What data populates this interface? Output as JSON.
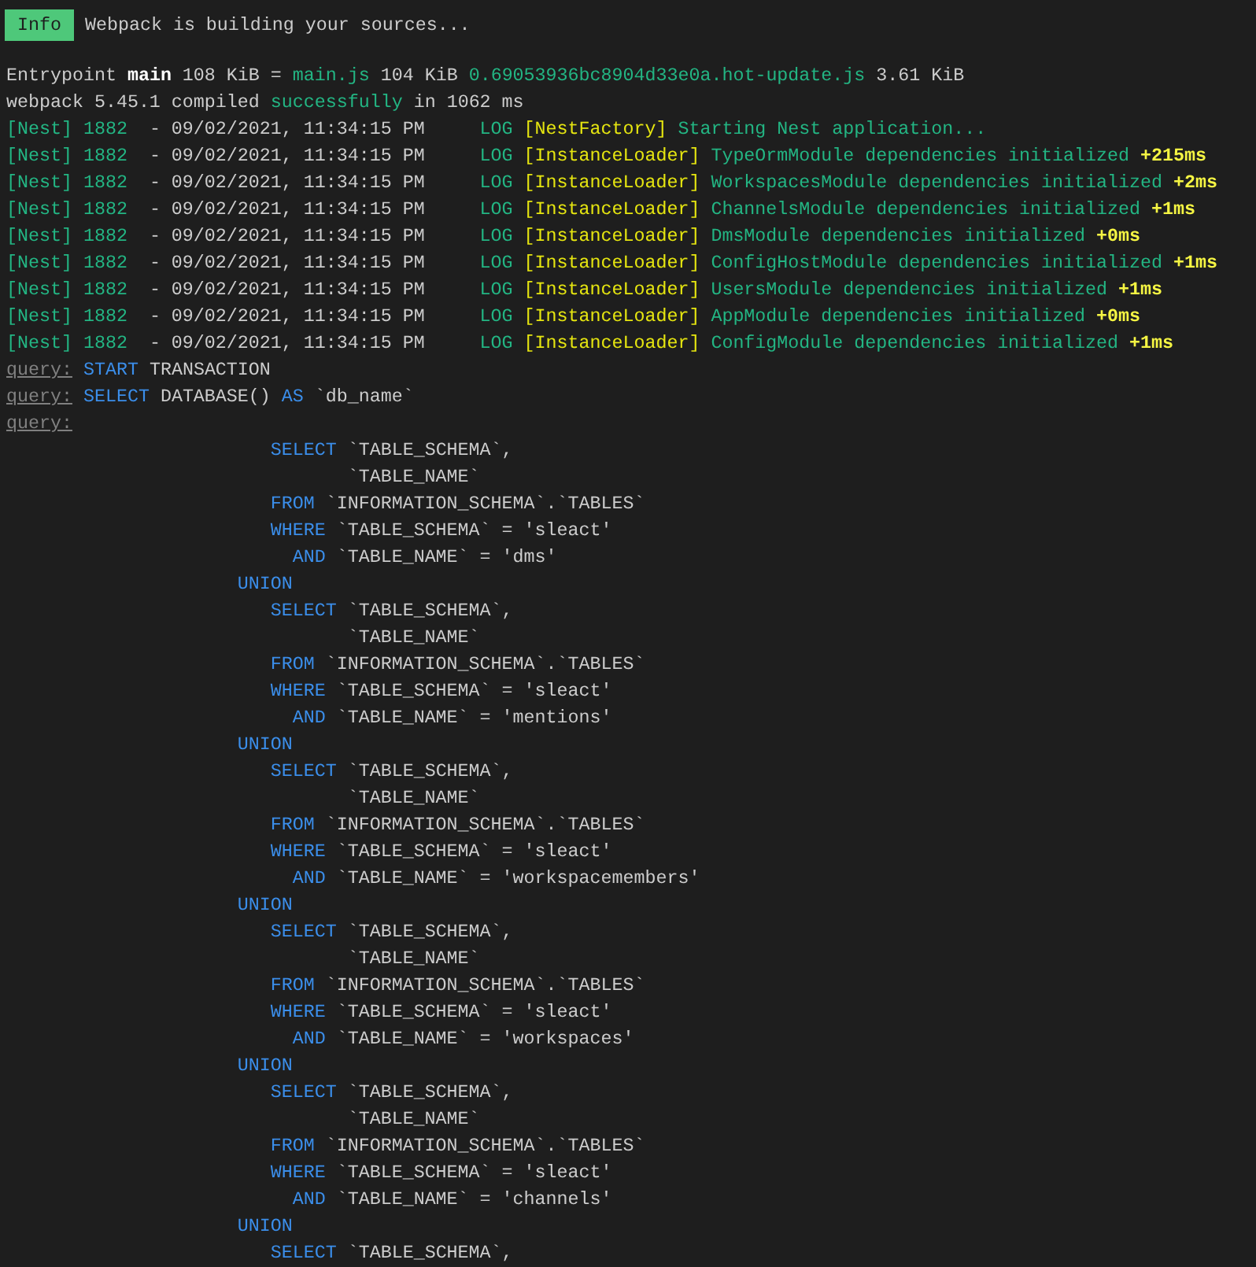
{
  "info": {
    "badge": "Info",
    "message": "Webpack is building your sources..."
  },
  "lines": [
    [
      {
        "kind": "plain",
        "text": "Entrypoint "
      },
      {
        "kind": "bold",
        "text": "main"
      },
      {
        "kind": "plain",
        "text": " 108 KiB = "
      },
      {
        "kind": "green",
        "text": "main.js"
      },
      {
        "kind": "plain",
        "text": " 104 KiB "
      },
      {
        "kind": "green",
        "text": "0.69053936bc8904d33e0a.hot-update.js"
      },
      {
        "kind": "plain",
        "text": " 3.61 KiB"
      }
    ],
    [
      {
        "kind": "plain",
        "text": "webpack 5.45.1 compiled "
      },
      {
        "kind": "green",
        "text": "successfully"
      },
      {
        "kind": "plain",
        "text": " in 1062 ms"
      }
    ],
    [
      {
        "kind": "green",
        "text": "[Nest] 1882"
      },
      {
        "kind": "plain",
        "text": "  - 09/02/2021, 11:34:15 PM     "
      },
      {
        "kind": "green",
        "text": "LOG "
      },
      {
        "kind": "yellow",
        "text": "[NestFactory]"
      },
      {
        "kind": "green",
        "text": " Starting Nest application..."
      }
    ],
    [
      {
        "kind": "green",
        "text": "[Nest] 1882"
      },
      {
        "kind": "plain",
        "text": "  - 09/02/2021, 11:34:15 PM     "
      },
      {
        "kind": "green",
        "text": "LOG "
      },
      {
        "kind": "yellow",
        "text": "[InstanceLoader]"
      },
      {
        "kind": "green",
        "text": " TypeOrmModule dependencies initialized "
      },
      {
        "kind": "timing",
        "text": "+215ms"
      }
    ],
    [
      {
        "kind": "green",
        "text": "[Nest] 1882"
      },
      {
        "kind": "plain",
        "text": "  - 09/02/2021, 11:34:15 PM     "
      },
      {
        "kind": "green",
        "text": "LOG "
      },
      {
        "kind": "yellow",
        "text": "[InstanceLoader]"
      },
      {
        "kind": "green",
        "text": " WorkspacesModule dependencies initialized "
      },
      {
        "kind": "timing",
        "text": "+2ms"
      }
    ],
    [
      {
        "kind": "green",
        "text": "[Nest] 1882"
      },
      {
        "kind": "plain",
        "text": "  - 09/02/2021, 11:34:15 PM     "
      },
      {
        "kind": "green",
        "text": "LOG "
      },
      {
        "kind": "yellow",
        "text": "[InstanceLoader]"
      },
      {
        "kind": "green",
        "text": " ChannelsModule dependencies initialized "
      },
      {
        "kind": "timing",
        "text": "+1ms"
      }
    ],
    [
      {
        "kind": "green",
        "text": "[Nest] 1882"
      },
      {
        "kind": "plain",
        "text": "  - 09/02/2021, 11:34:15 PM     "
      },
      {
        "kind": "green",
        "text": "LOG "
      },
      {
        "kind": "yellow",
        "text": "[InstanceLoader]"
      },
      {
        "kind": "green",
        "text": " DmsModule dependencies initialized "
      },
      {
        "kind": "timing",
        "text": "+0ms"
      }
    ],
    [
      {
        "kind": "green",
        "text": "[Nest] 1882"
      },
      {
        "kind": "plain",
        "text": "  - 09/02/2021, 11:34:15 PM     "
      },
      {
        "kind": "green",
        "text": "LOG "
      },
      {
        "kind": "yellow",
        "text": "[InstanceLoader]"
      },
      {
        "kind": "green",
        "text": " ConfigHostModule dependencies initialized "
      },
      {
        "kind": "timing",
        "text": "+1ms"
      }
    ],
    [
      {
        "kind": "green",
        "text": "[Nest] 1882"
      },
      {
        "kind": "plain",
        "text": "  - 09/02/2021, 11:34:15 PM     "
      },
      {
        "kind": "green",
        "text": "LOG "
      },
      {
        "kind": "yellow",
        "text": "[InstanceLoader]"
      },
      {
        "kind": "green",
        "text": " UsersModule dependencies initialized "
      },
      {
        "kind": "timing",
        "text": "+1ms"
      }
    ],
    [
      {
        "kind": "green",
        "text": "[Nest] 1882"
      },
      {
        "kind": "plain",
        "text": "  - 09/02/2021, 11:34:15 PM     "
      },
      {
        "kind": "green",
        "text": "LOG "
      },
      {
        "kind": "yellow",
        "text": "[InstanceLoader]"
      },
      {
        "kind": "green",
        "text": " AppModule dependencies initialized "
      },
      {
        "kind": "timing",
        "text": "+0ms"
      }
    ],
    [
      {
        "kind": "green",
        "text": "[Nest] 1882"
      },
      {
        "kind": "plain",
        "text": "  - 09/02/2021, 11:34:15 PM     "
      },
      {
        "kind": "green",
        "text": "LOG "
      },
      {
        "kind": "yellow",
        "text": "[InstanceLoader]"
      },
      {
        "kind": "green",
        "text": " ConfigModule dependencies initialized "
      },
      {
        "kind": "timing",
        "text": "+1ms"
      }
    ],
    [
      {
        "kind": "prefix",
        "text": "query:"
      },
      {
        "kind": "keyword",
        "text": " START"
      },
      {
        "kind": "plain",
        "text": " TRANSACTION"
      }
    ],
    [
      {
        "kind": "prefix",
        "text": "query:"
      },
      {
        "kind": "keyword",
        "text": " SELECT"
      },
      {
        "kind": "plain",
        "text": " DATABASE() "
      },
      {
        "kind": "keyword",
        "text": "AS"
      },
      {
        "kind": "plain",
        "text": " `db_name`"
      }
    ],
    [
      {
        "kind": "prefix",
        "text": "query:"
      }
    ],
    [
      {
        "kind": "keyword",
        "text": "                        SELECT"
      },
      {
        "kind": "plain",
        "text": " `TABLE_SCHEMA`,"
      }
    ],
    [
      {
        "kind": "plain",
        "text": "                               `TABLE_NAME`"
      }
    ],
    [
      {
        "kind": "keyword",
        "text": "                        FROM"
      },
      {
        "kind": "plain",
        "text": " `INFORMATION_SCHEMA`.`TABLES`"
      }
    ],
    [
      {
        "kind": "keyword",
        "text": "                        WHERE"
      },
      {
        "kind": "plain",
        "text": " `TABLE_SCHEMA` = 'sleact'"
      }
    ],
    [
      {
        "kind": "keyword",
        "text": "                          AND"
      },
      {
        "kind": "plain",
        "text": " `TABLE_NAME` = 'dms'"
      }
    ],
    [
      {
        "kind": "keyword",
        "text": "                     UNION"
      }
    ],
    [
      {
        "kind": "keyword",
        "text": "                        SELECT"
      },
      {
        "kind": "plain",
        "text": " `TABLE_SCHEMA`,"
      }
    ],
    [
      {
        "kind": "plain",
        "text": "                               `TABLE_NAME`"
      }
    ],
    [
      {
        "kind": "keyword",
        "text": "                        FROM"
      },
      {
        "kind": "plain",
        "text": " `INFORMATION_SCHEMA`.`TABLES`"
      }
    ],
    [
      {
        "kind": "keyword",
        "text": "                        WHERE"
      },
      {
        "kind": "plain",
        "text": " `TABLE_SCHEMA` = 'sleact'"
      }
    ],
    [
      {
        "kind": "keyword",
        "text": "                          AND"
      },
      {
        "kind": "plain",
        "text": " `TABLE_NAME` = 'mentions'"
      }
    ],
    [
      {
        "kind": "keyword",
        "text": "                     UNION"
      }
    ],
    [
      {
        "kind": "keyword",
        "text": "                        SELECT"
      },
      {
        "kind": "plain",
        "text": " `TABLE_SCHEMA`,"
      }
    ],
    [
      {
        "kind": "plain",
        "text": "                               `TABLE_NAME`"
      }
    ],
    [
      {
        "kind": "keyword",
        "text": "                        FROM"
      },
      {
        "kind": "plain",
        "text": " `INFORMATION_SCHEMA`.`TABLES`"
      }
    ],
    [
      {
        "kind": "keyword",
        "text": "                        WHERE"
      },
      {
        "kind": "plain",
        "text": " `TABLE_SCHEMA` = 'sleact'"
      }
    ],
    [
      {
        "kind": "keyword",
        "text": "                          AND"
      },
      {
        "kind": "plain",
        "text": " `TABLE_NAME` = 'workspacemembers'"
      }
    ],
    [
      {
        "kind": "keyword",
        "text": "                     UNION"
      }
    ],
    [
      {
        "kind": "keyword",
        "text": "                        SELECT"
      },
      {
        "kind": "plain",
        "text": " `TABLE_SCHEMA`,"
      }
    ],
    [
      {
        "kind": "plain",
        "text": "                               `TABLE_NAME`"
      }
    ],
    [
      {
        "kind": "keyword",
        "text": "                        FROM"
      },
      {
        "kind": "plain",
        "text": " `INFORMATION_SCHEMA`.`TABLES`"
      }
    ],
    [
      {
        "kind": "keyword",
        "text": "                        WHERE"
      },
      {
        "kind": "plain",
        "text": " `TABLE_SCHEMA` = 'sleact'"
      }
    ],
    [
      {
        "kind": "keyword",
        "text": "                          AND"
      },
      {
        "kind": "plain",
        "text": " `TABLE_NAME` = 'workspaces'"
      }
    ],
    [
      {
        "kind": "keyword",
        "text": "                     UNION"
      }
    ],
    [
      {
        "kind": "keyword",
        "text": "                        SELECT"
      },
      {
        "kind": "plain",
        "text": " `TABLE_SCHEMA`,"
      }
    ],
    [
      {
        "kind": "plain",
        "text": "                               `TABLE_NAME`"
      }
    ],
    [
      {
        "kind": "keyword",
        "text": "                        FROM"
      },
      {
        "kind": "plain",
        "text": " `INFORMATION_SCHEMA`.`TABLES`"
      }
    ],
    [
      {
        "kind": "keyword",
        "text": "                        WHERE"
      },
      {
        "kind": "plain",
        "text": " `TABLE_SCHEMA` = 'sleact'"
      }
    ],
    [
      {
        "kind": "keyword",
        "text": "                          AND"
      },
      {
        "kind": "plain",
        "text": " `TABLE_NAME` = 'channels'"
      }
    ],
    [
      {
        "kind": "keyword",
        "text": "                     UNION"
      }
    ],
    [
      {
        "kind": "keyword",
        "text": "                        SELECT"
      },
      {
        "kind": "plain",
        "text": " `TABLE_SCHEMA`,"
      }
    ]
  ]
}
